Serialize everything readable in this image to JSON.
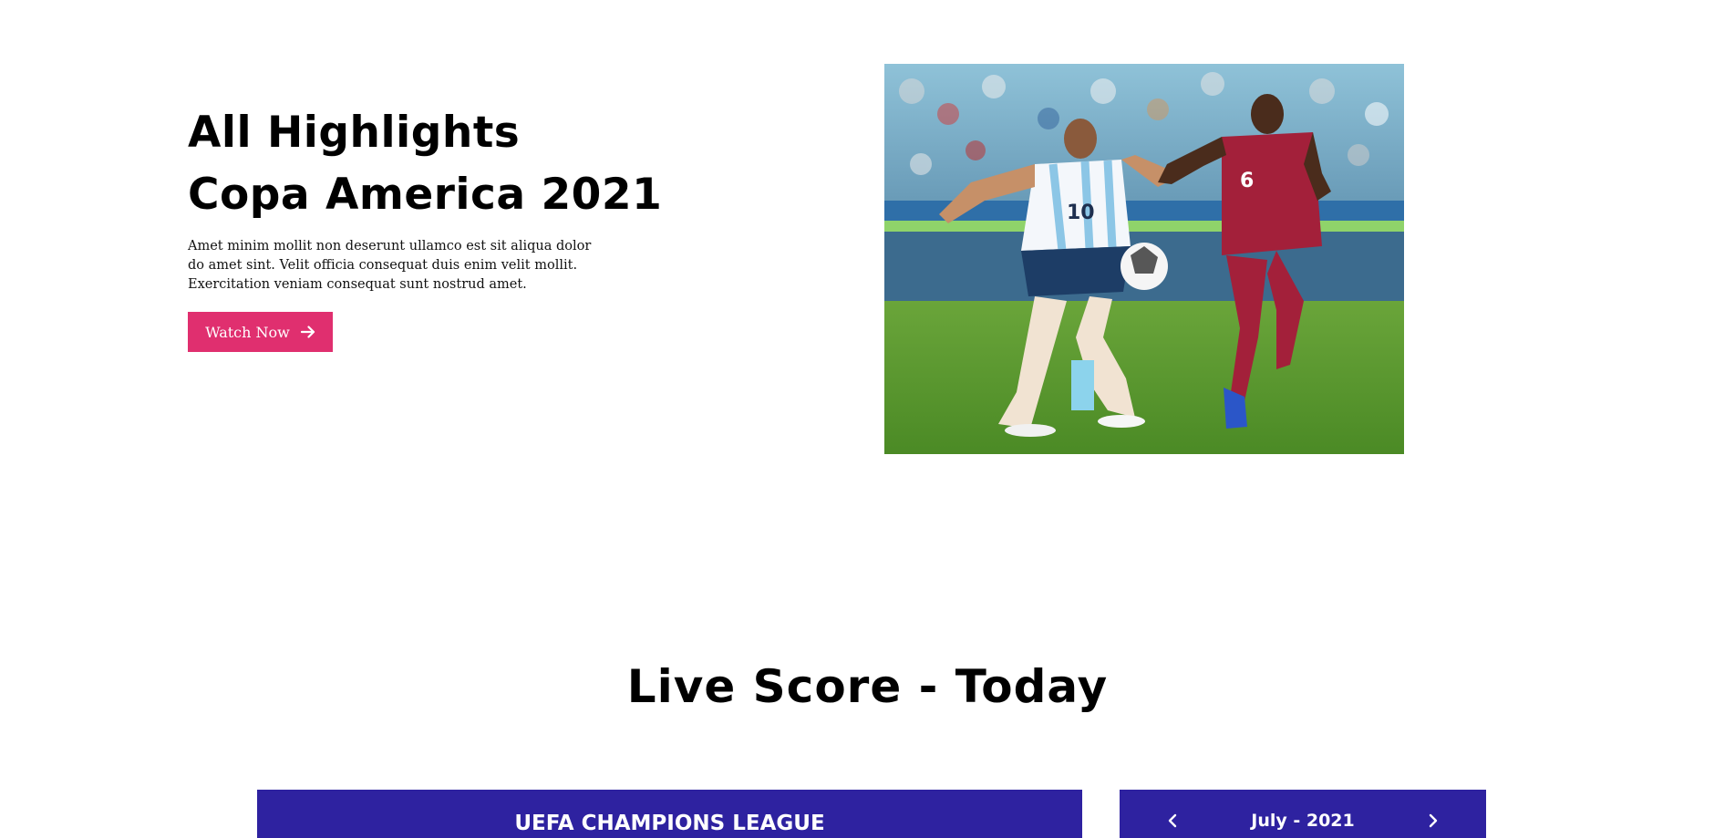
{
  "hero": {
    "title_line1": "All Highlights",
    "title_line2": "Copa America 2021",
    "description": "Amet minim mollit non deserunt ullamco est sit aliqua dolor do amet sint. Velit officia consequat duis enim velit mollit. Exercitation veniam consequat sunt nostrud amet.",
    "watch_label": "Watch Now",
    "watch_icon": "arrow-right-icon",
    "image_subject": "football-players-image",
    "accent_color": "#e02f6f"
  },
  "live_score": {
    "title": "Live Score - Today",
    "league_name": "UEFA CHAMPIONS LEAGUE",
    "month_label": "July - 2021",
    "prev_icon": "chevron-left-icon",
    "next_icon": "chevron-right-icon",
    "bar_color": "#2e22a0"
  },
  "photo": {
    "player1_number": "10",
    "player2_number": "6"
  }
}
